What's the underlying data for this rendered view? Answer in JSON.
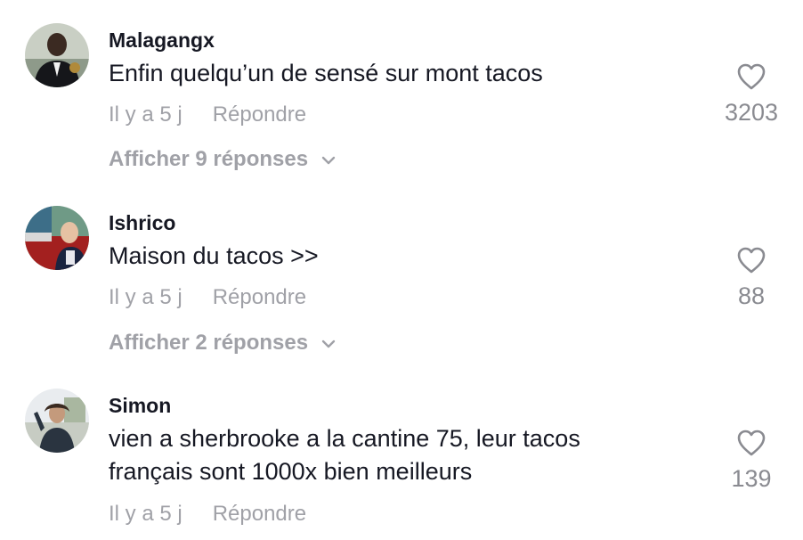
{
  "comments": [
    {
      "username": "Malagangx",
      "text": "Enfin quelqu’un de sensé sur mont tacos",
      "time": "Il y a 5 j",
      "reply_label": "Répondre",
      "likes": "3203",
      "view_replies": "Afficher 9 réponses",
      "avatar_icon": "avatar-photo"
    },
    {
      "username": "Ishrico",
      "text": "Maison du tacos >>",
      "time": "Il y a 5 j",
      "reply_label": "Répondre",
      "likes": "88",
      "view_replies": "Afficher 2 réponses",
      "avatar_icon": "avatar-photo"
    },
    {
      "username": "Simon",
      "text": "vien a sherbrooke a la cantine 75, leur tacos français sont 1000x bien meilleurs",
      "time": "Il y a 5 j",
      "reply_label": "Répondre",
      "likes": "139",
      "avatar_icon": "avatar-photo"
    }
  ],
  "colors": {
    "text_primary": "#161823",
    "text_muted": "#a0a1a7",
    "like_count": "#8a8b91"
  },
  "icons": {
    "like": "heart-outline-icon",
    "expand": "chevron-down-icon"
  }
}
